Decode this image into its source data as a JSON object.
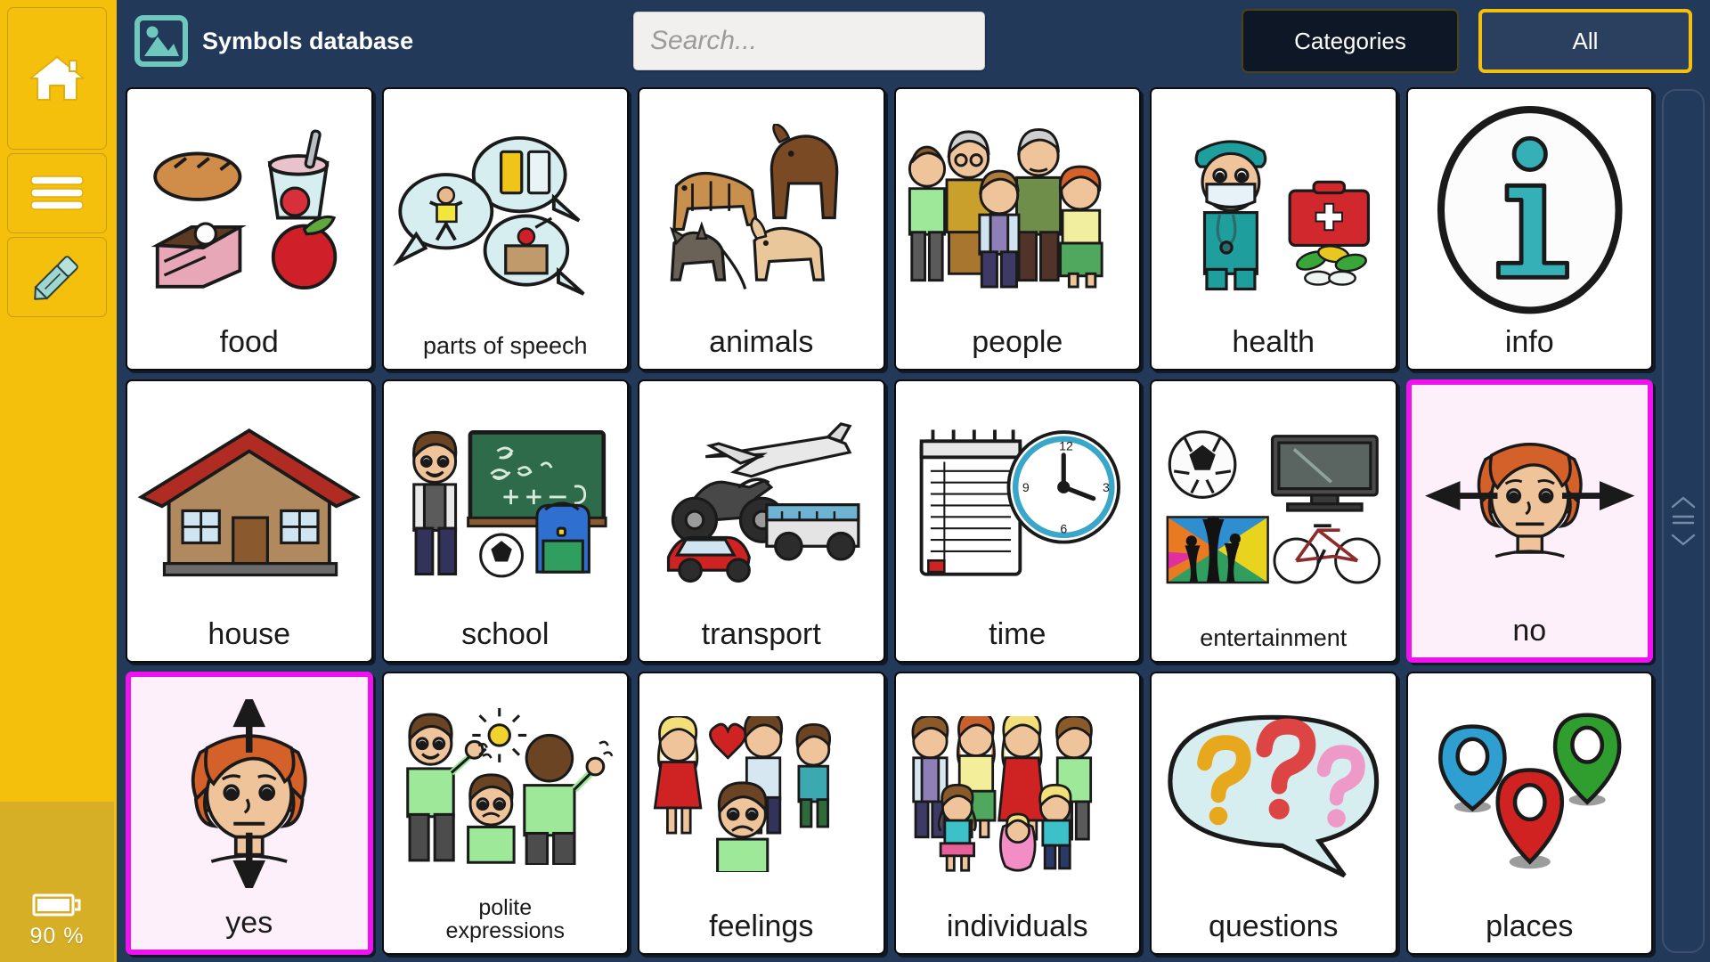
{
  "sidebar": {
    "buttons": [
      {
        "name": "home",
        "icon": "home-icon"
      },
      {
        "name": "menu",
        "icon": "hamburger-menu-icon"
      },
      {
        "name": "edit",
        "icon": "pencil-icon"
      }
    ],
    "battery": {
      "icon": "battery-icon",
      "percent_label": "90 %"
    }
  },
  "topbar": {
    "app_icon": "image-placeholder-icon",
    "title": "Symbols database",
    "search": {
      "value": "",
      "placeholder": "Search..."
    },
    "categories_label": "Categories",
    "all_label": "All"
  },
  "scrollbar": {
    "up_icon": "chevron-up-icon",
    "grip_icon": "grip-lines-icon",
    "down_icon": "chevron-down-icon"
  },
  "colors": {
    "sidebar": "#f4c00c",
    "sidebar_battery": "#d6af27",
    "background": "#22395a",
    "topbar": "#22395a",
    "accent_yellow": "#f4c00c",
    "selected_border": "#ef11ef",
    "selected_fill": "#fdf0fb",
    "categories_button": "#0d1725"
  },
  "grid": {
    "columns": 6,
    "rows": 3,
    "cards": [
      {
        "label": "food",
        "art": "food-art",
        "selected": false,
        "label_size": "lg"
      },
      {
        "label": "parts of speech",
        "art": "parts-of-speech-art",
        "selected": false,
        "label_size": "sm"
      },
      {
        "label": "animals",
        "art": "animals-art",
        "selected": false,
        "label_size": "lg"
      },
      {
        "label": "people",
        "art": "people-art",
        "selected": false,
        "label_size": "lg"
      },
      {
        "label": "health",
        "art": "health-art",
        "selected": false,
        "label_size": "lg"
      },
      {
        "label": "info",
        "art": "info-art",
        "selected": false,
        "label_size": "lg"
      },
      {
        "label": "house",
        "art": "house-art",
        "selected": false,
        "label_size": "lg"
      },
      {
        "label": "school",
        "art": "school-art",
        "selected": false,
        "label_size": "lg"
      },
      {
        "label": "transport",
        "art": "transport-art",
        "selected": false,
        "label_size": "lg"
      },
      {
        "label": "time",
        "art": "time-art",
        "selected": false,
        "label_size": "lg"
      },
      {
        "label": "entertainment",
        "art": "entertainment-art",
        "selected": false,
        "label_size": "sm"
      },
      {
        "label": "no",
        "art": "no-head-shake-art",
        "selected": true,
        "label_size": "lg"
      },
      {
        "label": "yes",
        "art": "yes-head-nod-art",
        "selected": true,
        "label_size": "lg"
      },
      {
        "label": "polite\nexpressions",
        "art": "polite-expressions-art",
        "selected": false,
        "label_size": "xs"
      },
      {
        "label": "feelings",
        "art": "feelings-art",
        "selected": false,
        "label_size": "lg"
      },
      {
        "label": "individuals",
        "art": "individuals-art",
        "selected": false,
        "label_size": "lg"
      },
      {
        "label": "questions",
        "art": "questions-art",
        "selected": false,
        "label_size": "lg"
      },
      {
        "label": "places",
        "art": "places-art",
        "selected": false,
        "label_size": "lg"
      }
    ]
  }
}
